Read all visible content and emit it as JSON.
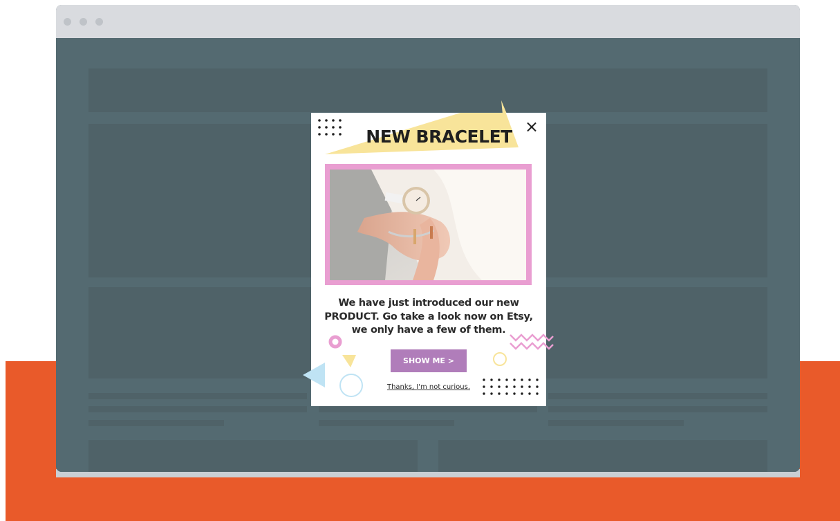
{
  "colors": {
    "page_bg": "#ffffff",
    "orange_band": "#e95a2a",
    "browser_titlebar": "#d9dbdf",
    "viewport_overlay": "#546a71",
    "placeholder_block": "#4f6268",
    "accent_yellow": "#f8e49a",
    "accent_pink": "#e99ed1",
    "accent_blue": "#bfe3f4",
    "cta_bg": "#b07dba"
  },
  "browser": {
    "window_controls": [
      "close-dot",
      "minimize-dot",
      "maximize-dot"
    ]
  },
  "popup": {
    "title": "NEW BRACELET",
    "close_icon": "close-icon",
    "image_alt": "Wrist with watch and bracelet",
    "description": "We have just introduced our new PRODUCT. Go take a look now on Etsy, we only have a few of them.",
    "cta_label": "SHOW ME >",
    "dismiss_label": "Thanks, I'm not curious."
  }
}
